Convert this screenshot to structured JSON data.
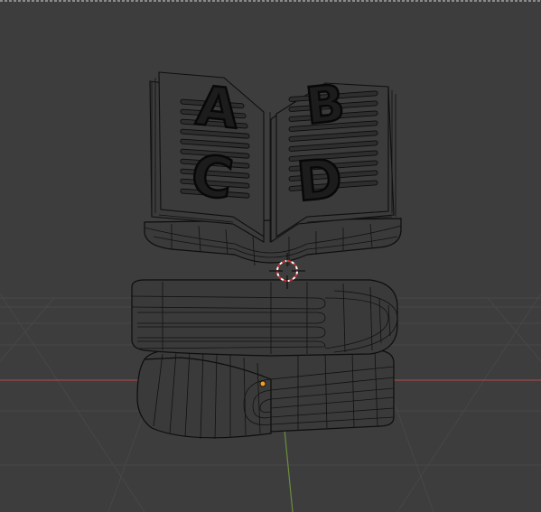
{
  "viewport": {
    "background": "#3d3d3d",
    "grid_color": "#474747",
    "x_axis_color": "#9b4a4a",
    "y_axis_color": "#6b8e3d"
  },
  "model": {
    "letters": [
      "A",
      "B",
      "C",
      "D"
    ]
  },
  "cursor": {
    "icon": "3d-cursor-icon"
  },
  "origin": {
    "icon": "object-origin-icon",
    "color": "#f0a030"
  }
}
